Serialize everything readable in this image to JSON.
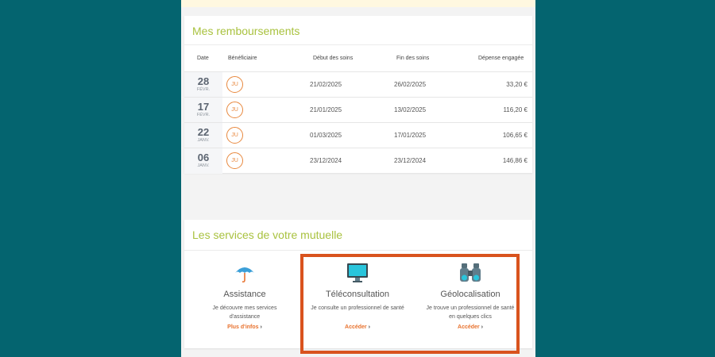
{
  "reimbursements": {
    "title": "Mes remboursements",
    "columns": [
      "Date",
      "Bénéficiaire",
      "Début des soins",
      "Fin des soins",
      "Dépense engagée"
    ],
    "rows": [
      {
        "day": "28",
        "month": "FÉVR.",
        "beneficiary": "JU",
        "start": "21/02/2025",
        "end": "26/02/2025",
        "amount": "33,20 €"
      },
      {
        "day": "17",
        "month": "FÉVR.",
        "beneficiary": "JU",
        "start": "21/01/2025",
        "end": "13/02/2025",
        "amount": "116,20 €"
      },
      {
        "day": "22",
        "month": "JANV.",
        "beneficiary": "JU",
        "start": "01/03/2025",
        "end": "17/01/2025",
        "amount": "106,65 €"
      },
      {
        "day": "06",
        "month": "JANV.",
        "beneficiary": "JU",
        "start": "23/12/2024",
        "end": "23/12/2024",
        "amount": "146,86 €"
      }
    ]
  },
  "services": {
    "title": "Les services de votre mutuelle",
    "items": [
      {
        "icon": "umbrella-icon",
        "title": "Assistance",
        "description": "Je découvre mes services d'assistance",
        "link": "Plus d'infos"
      },
      {
        "icon": "monitor-icon",
        "title": "Téléconsultation",
        "description": "Je consulte un professionnel de santé",
        "link": "Accéder"
      },
      {
        "icon": "binoculars-icon",
        "title": "Géolocalisation",
        "description": "Je trouve un professionnel de santé en quelques clics",
        "link": "Accéder"
      }
    ]
  },
  "colors": {
    "background": "#04646f",
    "accent_green": "#a9c23f",
    "accent_orange": "#e8722e",
    "highlight": "#d9531e"
  }
}
